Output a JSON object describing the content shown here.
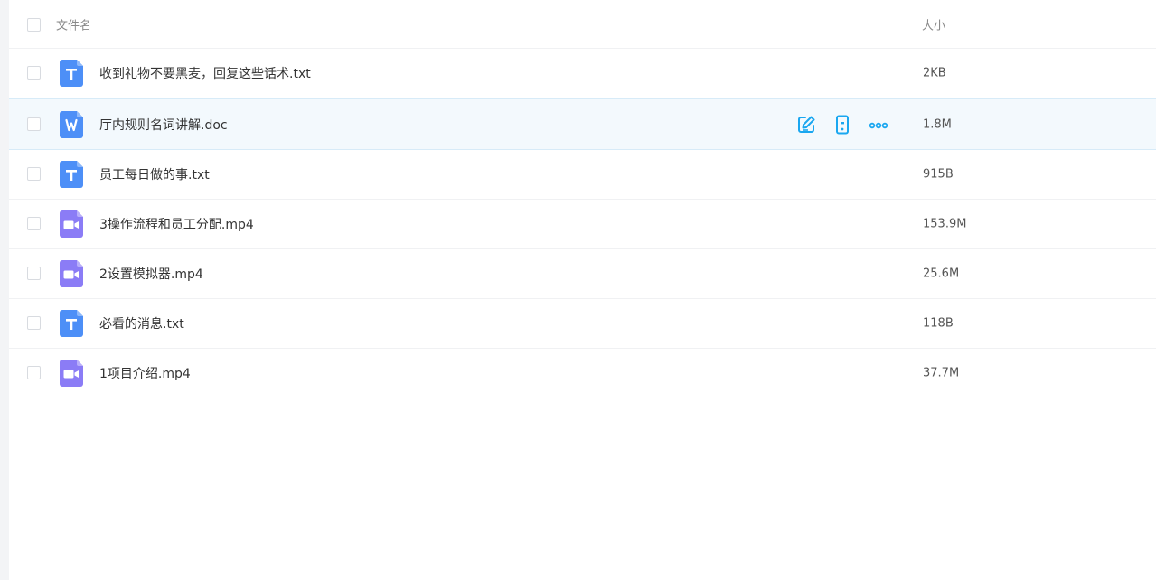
{
  "header": {
    "name_label": "文件名",
    "size_label": "大小"
  },
  "colors": {
    "text_icon": "#4d8ff7",
    "word_icon": "#4d8ff7",
    "video_icon": "#8b7cf6",
    "action_accent": "#1aa7f0"
  },
  "files": [
    {
      "name": "收到礼物不要黑麦，回复这些话术.txt",
      "size": "2KB",
      "type": "text-file-icon"
    },
    {
      "name": "厅内规则名词讲解.doc",
      "size": "1.8M",
      "type": "word-file-icon"
    },
    {
      "name": "员工每日做的事.txt",
      "size": "915B",
      "type": "text-file-icon"
    },
    {
      "name": "3操作流程和员工分配.mp4",
      "size": "153.9M",
      "type": "video-file-icon"
    },
    {
      "name": "2设置模拟器.mp4",
      "size": "25.6M",
      "type": "video-file-icon"
    },
    {
      "name": "必看的消息.txt",
      "size": "118B",
      "type": "text-file-icon"
    },
    {
      "name": "1项目介绍.mp4",
      "size": "37.7M",
      "type": "video-file-icon"
    }
  ],
  "hover_actions": [
    "edit-icon",
    "phone-icon",
    "more-icon"
  ]
}
